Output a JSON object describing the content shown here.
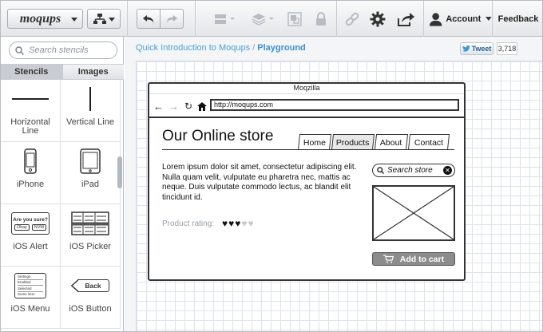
{
  "app": {
    "logo_text": "moqups"
  },
  "toolbar": {
    "account_label": "Account",
    "feedback_label": "Feedback"
  },
  "sidebar": {
    "search_placeholder": "Search stencils",
    "tabs": [
      {
        "label": "Stencils",
        "active": true
      },
      {
        "label": "Images",
        "active": false
      }
    ],
    "items": [
      {
        "label": "Horizontal Line",
        "icon": "horizontal-line-icon"
      },
      {
        "label": "Vertical Line",
        "icon": "vertical-line-icon"
      },
      {
        "label": "iPhone",
        "icon": "iphone-icon"
      },
      {
        "label": "iPad",
        "icon": "ipad-icon"
      },
      {
        "label": "iOS Alert",
        "icon": "ios-alert-icon",
        "preview_text": "Are you sure?",
        "preview_buttons": [
          "Okay",
          "NVM"
        ]
      },
      {
        "label": "iOS Picker",
        "icon": "ios-picker-icon"
      },
      {
        "label": "iOS Menu",
        "icon": "ios-menu-icon",
        "preview_items": [
          "Settings",
          "Enabled",
          "Selected",
          "Some item"
        ]
      },
      {
        "label": "iOS Button",
        "icon": "ios-button-icon",
        "preview_text": "Back"
      }
    ]
  },
  "main": {
    "breadcrumb": {
      "project": "Quick Introduction to Moqups",
      "separator": "/",
      "page": "Playground"
    },
    "tweet": {
      "label": "Tweet",
      "count": "3,718"
    }
  },
  "mockup": {
    "window_title": "Moqzilla",
    "url": "http://moqups.com",
    "store_title": "Our Online store",
    "tabs": [
      "Home",
      "Products",
      "About",
      "Contact"
    ],
    "active_tab": "Products",
    "body_text": "Lorem ipsum dolor sit amet, consectetur adipiscing elit. Nulla quam velit, vulputate eu pharetra nec, mattis ac neque. Duis vulputate commodo lectus, ac blandit elit tincidunt id.",
    "rating_label": "Product rating:",
    "rating": {
      "value": 3,
      "max": 5
    },
    "search_placeholder": "Search store",
    "cart_label": "Add to cart"
  },
  "colors": {
    "accent_link": "#3a8fd0",
    "toolbar_bg": "#e4e6e9",
    "button_gray": "#8c8c8c"
  }
}
